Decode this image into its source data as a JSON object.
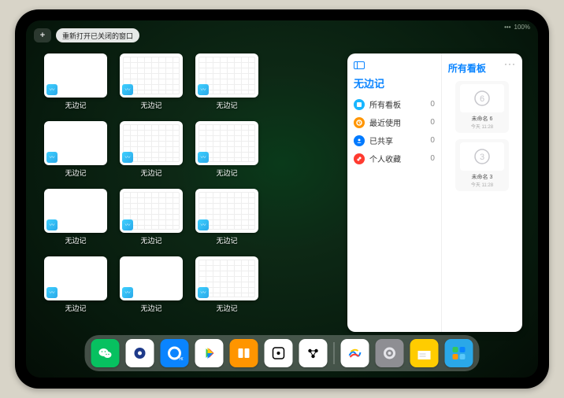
{
  "topbar": {
    "plus_label": "+",
    "reopen_label": "重新打开已关闭的窗口"
  },
  "status": {
    "signal": "•••",
    "battery": "100%"
  },
  "windows": [
    {
      "label": "无边记",
      "variant": "blank"
    },
    {
      "label": "无边记",
      "variant": "cal"
    },
    {
      "label": "无边记",
      "variant": "cal"
    },
    {
      "label": "",
      "variant": "none"
    },
    {
      "label": "无边记",
      "variant": "blank"
    },
    {
      "label": "无边记",
      "variant": "cal"
    },
    {
      "label": "无边记",
      "variant": "cal"
    },
    {
      "label": "",
      "variant": "none"
    },
    {
      "label": "无边记",
      "variant": "blank"
    },
    {
      "label": "无边记",
      "variant": "cal"
    },
    {
      "label": "无边记",
      "variant": "cal"
    },
    {
      "label": "",
      "variant": "none"
    },
    {
      "label": "无边记",
      "variant": "blank"
    },
    {
      "label": "无边记",
      "variant": "blank"
    },
    {
      "label": "无边记",
      "variant": "cal"
    }
  ],
  "card": {
    "left_title": "无边记",
    "items": [
      {
        "label": "所有看板",
        "count": "0",
        "color": "#18b6ff"
      },
      {
        "label": "最近使用",
        "count": "0",
        "color": "#ff9500"
      },
      {
        "label": "已共享",
        "count": "0",
        "color": "#007aff"
      },
      {
        "label": "个人收藏",
        "count": "0",
        "color": "#ff3b30"
      }
    ],
    "right_title": "所有看板",
    "boards": [
      {
        "glyph": "6",
        "name": "未命名 6",
        "time": "今天 11:28"
      },
      {
        "glyph": "3",
        "name": "未命名 3",
        "time": "今天 11:28"
      }
    ]
  },
  "dock": [
    {
      "name": "wechat",
      "bg": "#07c160",
      "glyph": "wechat"
    },
    {
      "name": "quark",
      "bg": "#ffffff",
      "glyph": "circle-blue"
    },
    {
      "name": "browser-hd",
      "bg": "#0a84ff",
      "glyph": "ring"
    },
    {
      "name": "play",
      "bg": "#ffffff",
      "glyph": "play"
    },
    {
      "name": "books",
      "bg": "#ff9500",
      "glyph": "books"
    },
    {
      "name": "dice",
      "bg": "#ffffff",
      "glyph": "die"
    },
    {
      "name": "contacts-alt",
      "bg": "#ffffff",
      "glyph": "dots"
    },
    {
      "name": "freeform",
      "bg": "#ffffff",
      "glyph": "scribble"
    },
    {
      "name": "settings",
      "bg": "#8e8e93",
      "glyph": "gear"
    },
    {
      "name": "notes",
      "bg": "#ffcc00",
      "glyph": "notes"
    },
    {
      "name": "app-library",
      "bg": "#2aa8e8",
      "glyph": "grid4"
    }
  ]
}
